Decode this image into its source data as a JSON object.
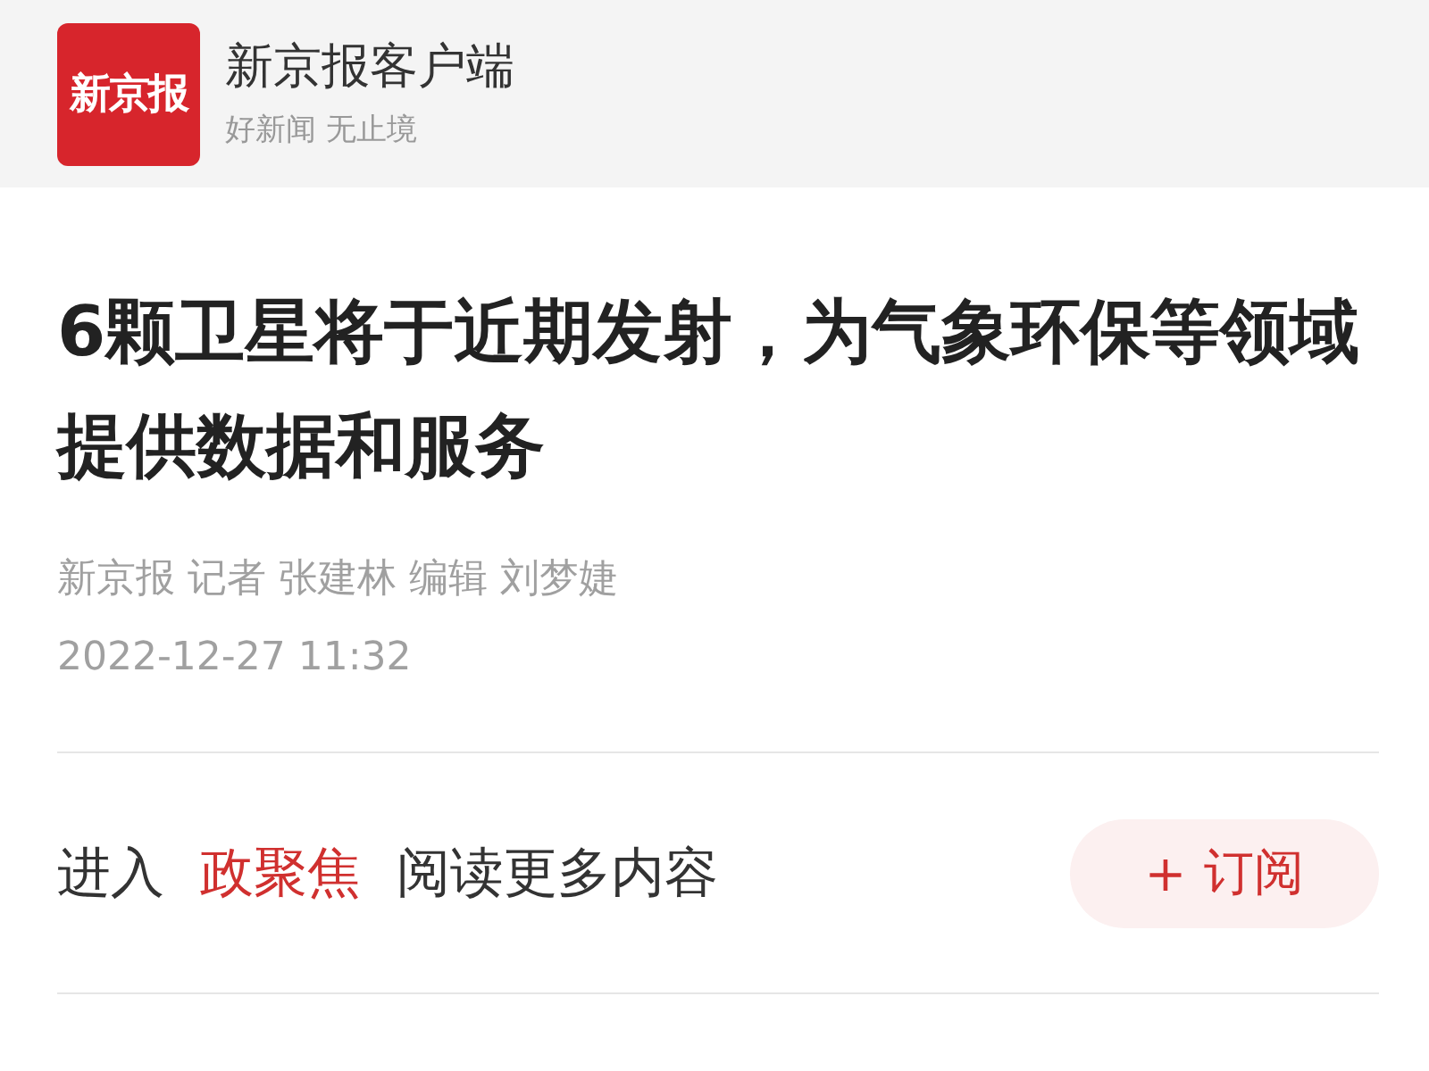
{
  "header": {
    "logo_text": "新京报",
    "app_name": "新京报客户端",
    "tagline": "好新闻 无止境"
  },
  "article": {
    "title": "6颗卫星将于近期发射，为气象环保等领域提供数据和服务",
    "byline": "新京报 记者 张建林 编辑 刘梦婕",
    "date": "2022-12-27 11:32"
  },
  "promo": {
    "prefix": "进入",
    "channel": "政聚焦",
    "suffix": "阅读更多内容"
  },
  "subscribe_button": {
    "icon": "+",
    "label": "订阅"
  }
}
